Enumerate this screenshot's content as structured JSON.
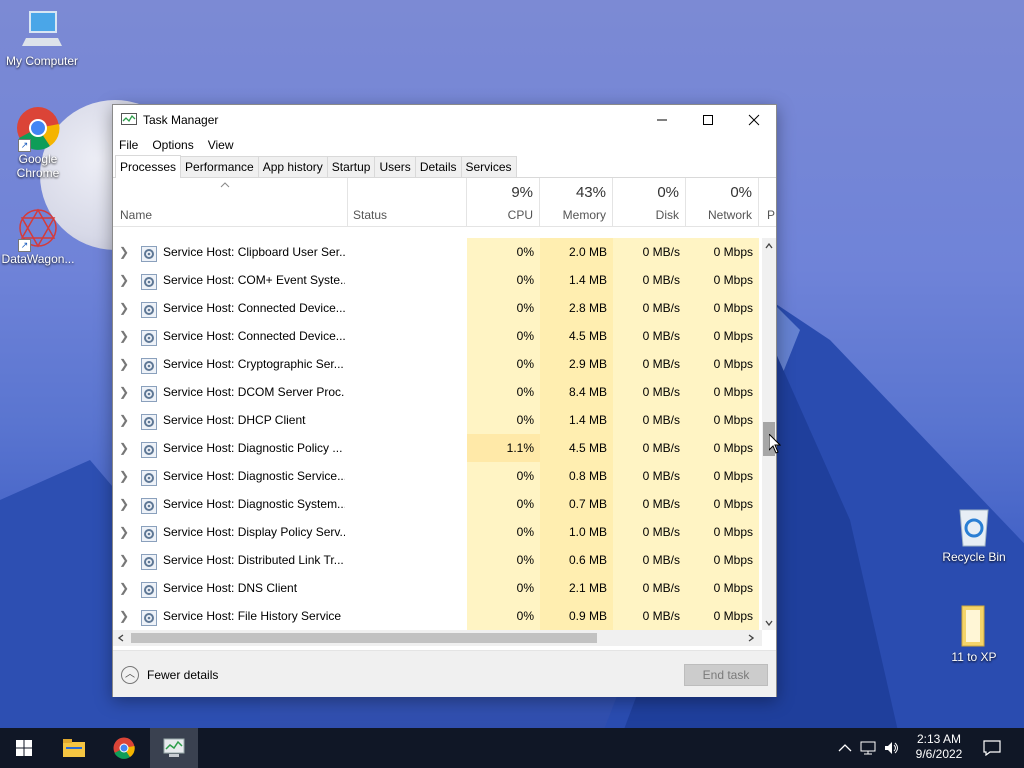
{
  "desktop": {
    "icons": [
      {
        "id": "my-computer",
        "label": "My Computer"
      },
      {
        "id": "google-chrome",
        "label": "Google Chrome"
      },
      {
        "id": "datawagon",
        "label": "DataWagon..."
      },
      {
        "id": "recycle-bin",
        "label": "Recycle Bin"
      },
      {
        "id": "folder-11-to-xp",
        "label": "11 to XP"
      }
    ]
  },
  "window": {
    "title": "Task Manager",
    "menu": [
      "File",
      "Options",
      "View"
    ],
    "tabs": [
      "Processes",
      "Performance",
      "App history",
      "Startup",
      "Users",
      "Details",
      "Services"
    ],
    "active_tab": "Processes",
    "columns": {
      "name": "Name",
      "status": "Status",
      "cpu": {
        "pct": "9%",
        "label": "CPU"
      },
      "memory": {
        "pct": "43%",
        "label": "Memory"
      },
      "disk": {
        "pct": "0%",
        "label": "Disk"
      },
      "network": {
        "pct": "0%",
        "label": "Network"
      },
      "power": "P"
    },
    "rows": [
      {
        "name": "Service Host: Clipboard User Ser...",
        "cpu": "0%",
        "mem": "2.0 MB",
        "disk": "0 MB/s",
        "net": "0 Mbps"
      },
      {
        "name": "Service Host: COM+ Event Syste...",
        "cpu": "0%",
        "mem": "1.4 MB",
        "disk": "0 MB/s",
        "net": "0 Mbps"
      },
      {
        "name": "Service Host: Connected Device...",
        "cpu": "0%",
        "mem": "2.8 MB",
        "disk": "0 MB/s",
        "net": "0 Mbps"
      },
      {
        "name": "Service Host: Connected Device...",
        "cpu": "0%",
        "mem": "4.5 MB",
        "disk": "0 MB/s",
        "net": "0 Mbps"
      },
      {
        "name": "Service Host: Cryptographic Ser...",
        "cpu": "0%",
        "mem": "2.9 MB",
        "disk": "0 MB/s",
        "net": "0 Mbps"
      },
      {
        "name": "Service Host: DCOM Server Proc...",
        "cpu": "0%",
        "mem": "8.4 MB",
        "disk": "0 MB/s",
        "net": "0 Mbps"
      },
      {
        "name": "Service Host: DHCP Client",
        "cpu": "0%",
        "mem": "1.4 MB",
        "disk": "0 MB/s",
        "net": "0 Mbps"
      },
      {
        "name": "Service Host: Diagnostic Policy ...",
        "cpu": "1.1%",
        "mem": "4.5 MB",
        "disk": "0 MB/s",
        "net": "0 Mbps"
      },
      {
        "name": "Service Host: Diagnostic Service...",
        "cpu": "0%",
        "mem": "0.8 MB",
        "disk": "0 MB/s",
        "net": "0 Mbps"
      },
      {
        "name": "Service Host: Diagnostic System...",
        "cpu": "0%",
        "mem": "0.7 MB",
        "disk": "0 MB/s",
        "net": "0 Mbps"
      },
      {
        "name": "Service Host: Display Policy Serv...",
        "cpu": "0%",
        "mem": "1.0 MB",
        "disk": "0 MB/s",
        "net": "0 Mbps"
      },
      {
        "name": "Service Host: Distributed Link Tr...",
        "cpu": "0%",
        "mem": "0.6 MB",
        "disk": "0 MB/s",
        "net": "0 Mbps"
      },
      {
        "name": "Service Host: DNS Client",
        "cpu": "0%",
        "mem": "2.1 MB",
        "disk": "0 MB/s",
        "net": "0 Mbps"
      },
      {
        "name": "Service Host: File History Service",
        "cpu": "0%",
        "mem": "0.9 MB",
        "disk": "0 MB/s",
        "net": "0 Mbps"
      }
    ],
    "fewer_details": "Fewer details",
    "end_task": "End task"
  },
  "taskbar": {
    "clock_time": "2:13 AM",
    "clock_date": "9/6/2022"
  },
  "colors": {
    "cpu_bg": "#fff4c4",
    "mem_bg": "#ffeeb0",
    "taskbar": "#101726"
  }
}
